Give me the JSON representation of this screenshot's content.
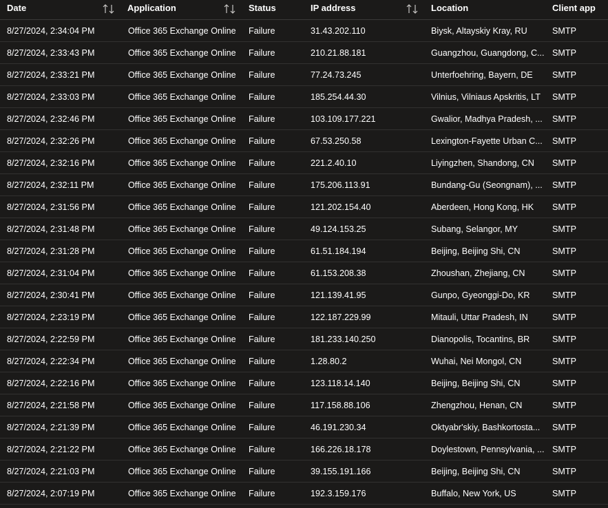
{
  "columns": {
    "date": "Date",
    "application": "Application",
    "status": "Status",
    "ip": "IP address",
    "location": "Location",
    "client_app": "Client app"
  },
  "rows": [
    {
      "date": "8/27/2024, 2:34:04 PM",
      "application": "Office 365 Exchange Online",
      "status": "Failure",
      "ip": "31.43.202.110",
      "location": "Biysk, Altayskiy Kray, RU",
      "client_app": "SMTP"
    },
    {
      "date": "8/27/2024, 2:33:43 PM",
      "application": "Office 365 Exchange Online",
      "status": "Failure",
      "ip": "210.21.88.181",
      "location": "Guangzhou, Guangdong, C...",
      "client_app": "SMTP"
    },
    {
      "date": "8/27/2024, 2:33:21 PM",
      "application": "Office 365 Exchange Online",
      "status": "Failure",
      "ip": "77.24.73.245",
      "location": "Unterfoehring, Bayern, DE",
      "client_app": "SMTP"
    },
    {
      "date": "8/27/2024, 2:33:03 PM",
      "application": "Office 365 Exchange Online",
      "status": "Failure",
      "ip": "185.254.44.30",
      "location": "Vilnius, Vilniaus Apskritis, LT",
      "client_app": "SMTP"
    },
    {
      "date": "8/27/2024, 2:32:46 PM",
      "application": "Office 365 Exchange Online",
      "status": "Failure",
      "ip": "103.109.177.221",
      "location": "Gwalior, Madhya Pradesh, ...",
      "client_app": "SMTP"
    },
    {
      "date": "8/27/2024, 2:32:26 PM",
      "application": "Office 365 Exchange Online",
      "status": "Failure",
      "ip": "67.53.250.58",
      "location": "Lexington-Fayette Urban C...",
      "client_app": "SMTP"
    },
    {
      "date": "8/27/2024, 2:32:16 PM",
      "application": "Office 365 Exchange Online",
      "status": "Failure",
      "ip": "221.2.40.10",
      "location": "Liyingzhen, Shandong, CN",
      "client_app": "SMTP"
    },
    {
      "date": "8/27/2024, 2:32:11 PM",
      "application": "Office 365 Exchange Online",
      "status": "Failure",
      "ip": "175.206.113.91",
      "location": "Bundang-Gu (Seongnam), ...",
      "client_app": "SMTP"
    },
    {
      "date": "8/27/2024, 2:31:56 PM",
      "application": "Office 365 Exchange Online",
      "status": "Failure",
      "ip": "121.202.154.40",
      "location": "Aberdeen, Hong Kong, HK",
      "client_app": "SMTP"
    },
    {
      "date": "8/27/2024, 2:31:48 PM",
      "application": "Office 365 Exchange Online",
      "status": "Failure",
      "ip": "49.124.153.25",
      "location": "Subang, Selangor, MY",
      "client_app": "SMTP"
    },
    {
      "date": "8/27/2024, 2:31:28 PM",
      "application": "Office 365 Exchange Online",
      "status": "Failure",
      "ip": "61.51.184.194",
      "location": "Beijing, Beijing Shi, CN",
      "client_app": "SMTP"
    },
    {
      "date": "8/27/2024, 2:31:04 PM",
      "application": "Office 365 Exchange Online",
      "status": "Failure",
      "ip": "61.153.208.38",
      "location": "Zhoushan, Zhejiang, CN",
      "client_app": "SMTP"
    },
    {
      "date": "8/27/2024, 2:30:41 PM",
      "application": "Office 365 Exchange Online",
      "status": "Failure",
      "ip": "121.139.41.95",
      "location": "Gunpo, Gyeonggi-Do, KR",
      "client_app": "SMTP"
    },
    {
      "date": "8/27/2024, 2:23:19 PM",
      "application": "Office 365 Exchange Online",
      "status": "Failure",
      "ip": "122.187.229.99",
      "location": "Mitauli, Uttar Pradesh, IN",
      "client_app": "SMTP"
    },
    {
      "date": "8/27/2024, 2:22:59 PM",
      "application": "Office 365 Exchange Online",
      "status": "Failure",
      "ip": "181.233.140.250",
      "location": "Dianopolis, Tocantins, BR",
      "client_app": "SMTP"
    },
    {
      "date": "8/27/2024, 2:22:34 PM",
      "application": "Office 365 Exchange Online",
      "status": "Failure",
      "ip": "1.28.80.2",
      "location": "Wuhai, Nei Mongol, CN",
      "client_app": "SMTP"
    },
    {
      "date": "8/27/2024, 2:22:16 PM",
      "application": "Office 365 Exchange Online",
      "status": "Failure",
      "ip": "123.118.14.140",
      "location": "Beijing, Beijing Shi, CN",
      "client_app": "SMTP"
    },
    {
      "date": "8/27/2024, 2:21:58 PM",
      "application": "Office 365 Exchange Online",
      "status": "Failure",
      "ip": "117.158.88.106",
      "location": "Zhengzhou, Henan, CN",
      "client_app": "SMTP"
    },
    {
      "date": "8/27/2024, 2:21:39 PM",
      "application": "Office 365 Exchange Online",
      "status": "Failure",
      "ip": "46.191.230.34",
      "location": "Oktyabr'skiy, Bashkortosta...",
      "client_app": "SMTP"
    },
    {
      "date": "8/27/2024, 2:21:22 PM",
      "application": "Office 365 Exchange Online",
      "status": "Failure",
      "ip": "166.226.18.178",
      "location": "Doylestown, Pennsylvania, ...",
      "client_app": "SMTP"
    },
    {
      "date": "8/27/2024, 2:21:03 PM",
      "application": "Office 365 Exchange Online",
      "status": "Failure",
      "ip": "39.155.191.166",
      "location": "Beijing, Beijing Shi, CN",
      "client_app": "SMTP"
    },
    {
      "date": "8/27/2024, 2:07:19 PM",
      "application": "Office 365 Exchange Online",
      "status": "Failure",
      "ip": "192.3.159.176",
      "location": "Buffalo, New York, US",
      "client_app": "SMTP"
    }
  ],
  "icons": {
    "sort": "sort-arrows-icon"
  },
  "colors": {
    "background": "#1b1a19",
    "text": "#ffffff",
    "divider": "#323130",
    "sort_icon": "#c8c6c4"
  }
}
